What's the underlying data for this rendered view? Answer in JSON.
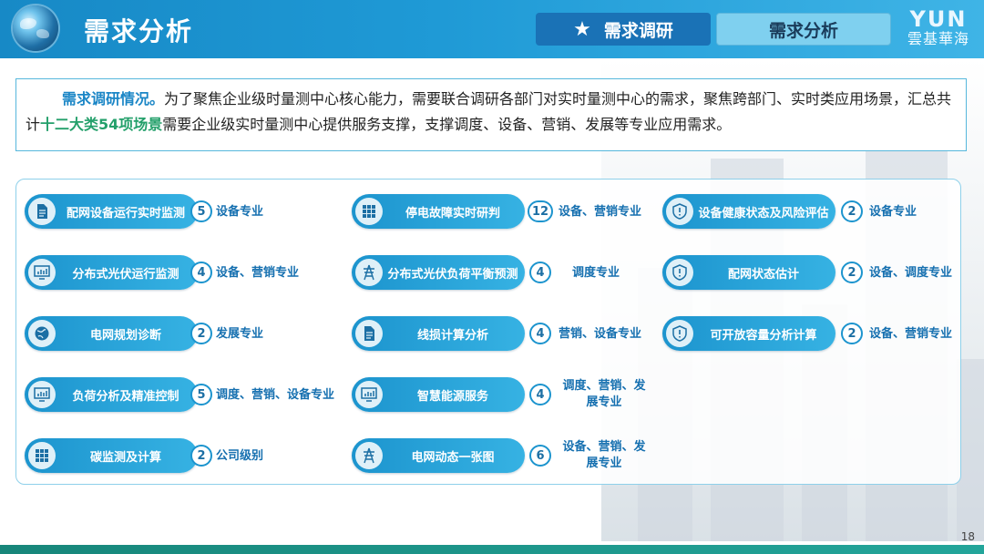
{
  "header": {
    "title": "需求分析",
    "nav": [
      {
        "label": "需求调研",
        "active": true
      },
      {
        "label": "需求分析",
        "active": false
      }
    ],
    "logo_mark": "YUN",
    "logo_sub": "雲基華海"
  },
  "intro": {
    "lead": "需求调研情况。",
    "text_a": "为了聚焦企业级时量测中心核心能力，需要联合调研各部门对实时量测中心的需求，聚焦跨部门、实时类应用场景，汇总共计",
    "highlight": "十二大类54项场景",
    "text_b": "需要企业级实时量测中心提供服务支撑，支撑调度、设备、营销、发展等专业应用需求。"
  },
  "scenes": {
    "col1": [
      {
        "label": "配网设备运行实时监测",
        "count": "5",
        "spec": "设备专业",
        "icon": "document-icon"
      },
      {
        "label": "分布式光伏运行监测",
        "count": "4",
        "spec": "设备、营销专业",
        "icon": "monitor-chart-icon"
      },
      {
        "label": "电网规划诊断",
        "count": "2",
        "spec": "发展专业",
        "icon": "globe-icon"
      },
      {
        "label": "负荷分析及精准控制",
        "count": "5",
        "spec": "调度、营销、设备专业",
        "icon": "monitor-chart-icon"
      },
      {
        "label": "碳监测及计算",
        "count": "2",
        "spec": "公司级别",
        "icon": "grid-icon"
      }
    ],
    "col2": [
      {
        "label": "停电故障实时研判",
        "count": "12",
        "spec": "设备、营销专业",
        "icon": "grid-icon"
      },
      {
        "label": "分布式光伏负荷平衡预测",
        "count": "4",
        "spec": "调度专业",
        "icon": "power-tower-icon"
      },
      {
        "label": "线损计算分析",
        "count": "4",
        "spec": "营销、设备专业",
        "icon": "document-icon"
      },
      {
        "label": "智慧能源服务",
        "count": "4",
        "spec": "调度、营销、发展专业",
        "icon": "monitor-chart-icon"
      },
      {
        "label": "电网动态一张图",
        "count": "6",
        "spec": "设备、营销、发展专业",
        "icon": "power-tower-icon"
      }
    ],
    "col3": [
      {
        "label": "设备健康状态及风险评估",
        "count": "2",
        "spec": "设备专业",
        "icon": "shield-icon"
      },
      {
        "label": "配网状态估计",
        "count": "2",
        "spec": "设备、调度专业",
        "icon": "shield-icon"
      },
      {
        "label": "可开放容量分析计算",
        "count": "2",
        "spec": "设备、营销专业",
        "icon": "shield-icon"
      }
    ]
  },
  "page_number": "18",
  "colors": {
    "header": "#1f9ad6",
    "pill": "#1c94ce",
    "specialty_text": "#1670b0",
    "highlight": "#24a06b",
    "footer": "#17867a"
  }
}
